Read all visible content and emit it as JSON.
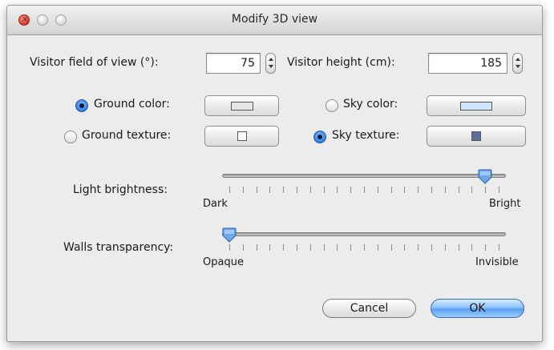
{
  "window": {
    "title": "Modify 3D view"
  },
  "field_of_view": {
    "label": "Visitor field of view (°):",
    "value": "75"
  },
  "visitor_height": {
    "label": "Visitor height (cm):",
    "value": "185"
  },
  "ground": {
    "color_label": "Ground color:",
    "texture_label": "Ground texture:",
    "selected": "color",
    "color_swatch": "#e6e6e6"
  },
  "sky": {
    "color_label": "Sky color:",
    "texture_label": "Sky texture:",
    "selected": "texture",
    "color_swatch": "#cfe5fb",
    "texture_swatch": "#5a6f9a"
  },
  "light_brightness": {
    "label": "Light brightness:",
    "min_label": "Dark",
    "max_label": "Bright",
    "level": 0.95
  },
  "walls_transparency": {
    "label": "Walls transparency:",
    "min_label": "Opaque",
    "max_label": "Invisible",
    "level": 0.0
  },
  "buttons": {
    "cancel": "Cancel",
    "ok": "OK"
  },
  "colors": {
    "accent": "#5aa0f0"
  }
}
